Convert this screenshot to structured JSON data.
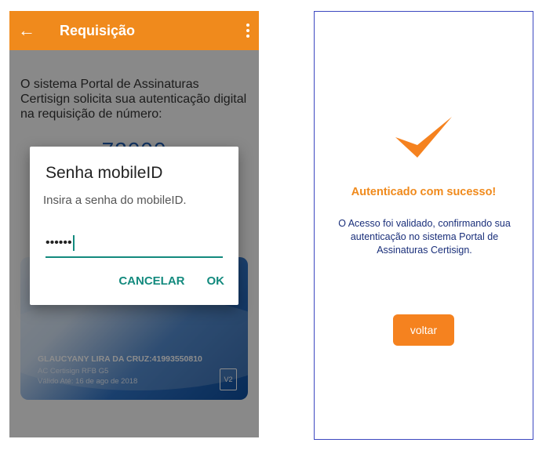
{
  "left_screen": {
    "appbar": {
      "title": "Requisição",
      "back_icon": "arrow-left-icon",
      "menu_icon": "more-vert-icon",
      "color": "#f08a1c"
    },
    "request_message": "O sistema Portal de Assinaturas Certisign solicita sua autenticação digital na requisição de número:",
    "request_number": "72000",
    "certificate_card": {
      "holder": "GLAUCYANY LIRA DA CRUZ:41993550810",
      "issuer": "AC Certisign RFB G5",
      "validity": "Válido Até: 16 de ago de 2018",
      "badge": "V2"
    },
    "dialog": {
      "title": "Senha mobileID",
      "message": "Insira a senha do mobileID.",
      "password_value": "••••••",
      "cancel_label": "CANCELAR",
      "ok_label": "OK",
      "accent": "#138a7e"
    }
  },
  "right_screen": {
    "check_icon": "checkmark-icon",
    "title": "Autenticado com sucesso!",
    "message": "O Acesso foi validado, confirmando sua autenticação no sistema Portal de Assinaturas Certisign.",
    "button_label": "voltar",
    "accent": "#f08a1c"
  }
}
